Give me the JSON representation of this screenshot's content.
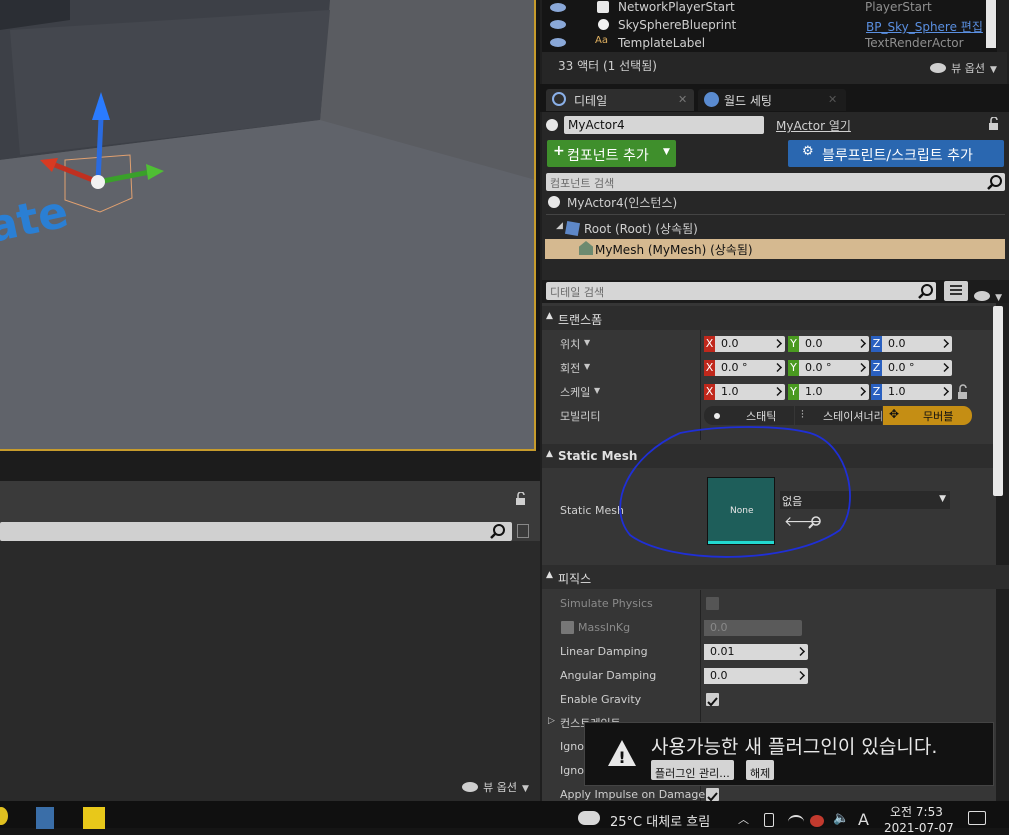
{
  "outliner": {
    "rows": [
      {
        "name": "NetworkPlayerStart",
        "type": "PlayerStart",
        "link": false
      },
      {
        "name": "SkySphereBlueprint",
        "type": "BP_Sky_Sphere 편집",
        "link": true
      },
      {
        "name": "TemplateLabel",
        "type": "TextRenderActor",
        "link": false
      }
    ],
    "count_text": "33 액터 (1 선택됨)",
    "view_options": "뷰 옵션"
  },
  "tabs": {
    "details": "디테일",
    "world_settings": "월드 세팅"
  },
  "actor": {
    "name_value": "MyActor4",
    "open_link": "MyActor 열기",
    "add_component": "컴포넌트 추가",
    "add_blueprint": "블루프린트/스크립트 추가",
    "component_search_placeholder": "컴포넌트 검색",
    "instance_label": "MyActor4(인스턴스)",
    "root_label": "Root (Root) (상속됨)",
    "mesh_label": "MyMesh (MyMesh) (상속됨)",
    "detail_search_placeholder": "디테일 검색"
  },
  "transform": {
    "header": "트랜스폼",
    "location_label": "위치",
    "rotation_label": "회전",
    "scale_label": "스케일",
    "mobility_label": "모빌리티",
    "location": [
      "0.0",
      "0.0",
      "0.0"
    ],
    "rotation": [
      "0.0 °",
      "0.0 °",
      "0.0 °"
    ],
    "scale": [
      "1.0",
      "1.0",
      "1.0"
    ],
    "mobility_options": [
      "스태틱",
      "스테이셔너리",
      "무버블"
    ],
    "axes": [
      "X",
      "Y",
      "Z"
    ]
  },
  "static_mesh": {
    "header": "Static Mesh",
    "label": "Static Mesh",
    "thumb_text": "None",
    "combo_value": "없음"
  },
  "physics": {
    "header": "피직스",
    "simulate": "Simulate Physics",
    "mass": "MassInKg",
    "mass_value": "0.0",
    "linear": "Linear Damping",
    "linear_value": "0.01",
    "angular": "Angular Damping",
    "angular_value": "0.0",
    "gravity": "Enable Gravity",
    "constraints": "컨스트레인트",
    "ignore1": "Ignor",
    "ignore2": "Ignor",
    "impulse": "Apply Impulse on Damage"
  },
  "notification": {
    "message": "사용가능한 새 플러그인이 있습니다.",
    "manage": "플러그인 관리...",
    "dismiss": "해제"
  },
  "left_lower": {
    "view_options": "뷰 옵션"
  },
  "viewport": {
    "text_fragment": "ate"
  },
  "taskbar": {
    "weather": "25°C  대체로 흐림",
    "time": "오전 7:53",
    "date": "2021-07-07",
    "ime": "A"
  },
  "colors": {
    "selection": "#c69b2c",
    "mesh_row": "#d5b990",
    "accent_blue": "#2a67b0",
    "accent_green": "#3f8f2c"
  }
}
